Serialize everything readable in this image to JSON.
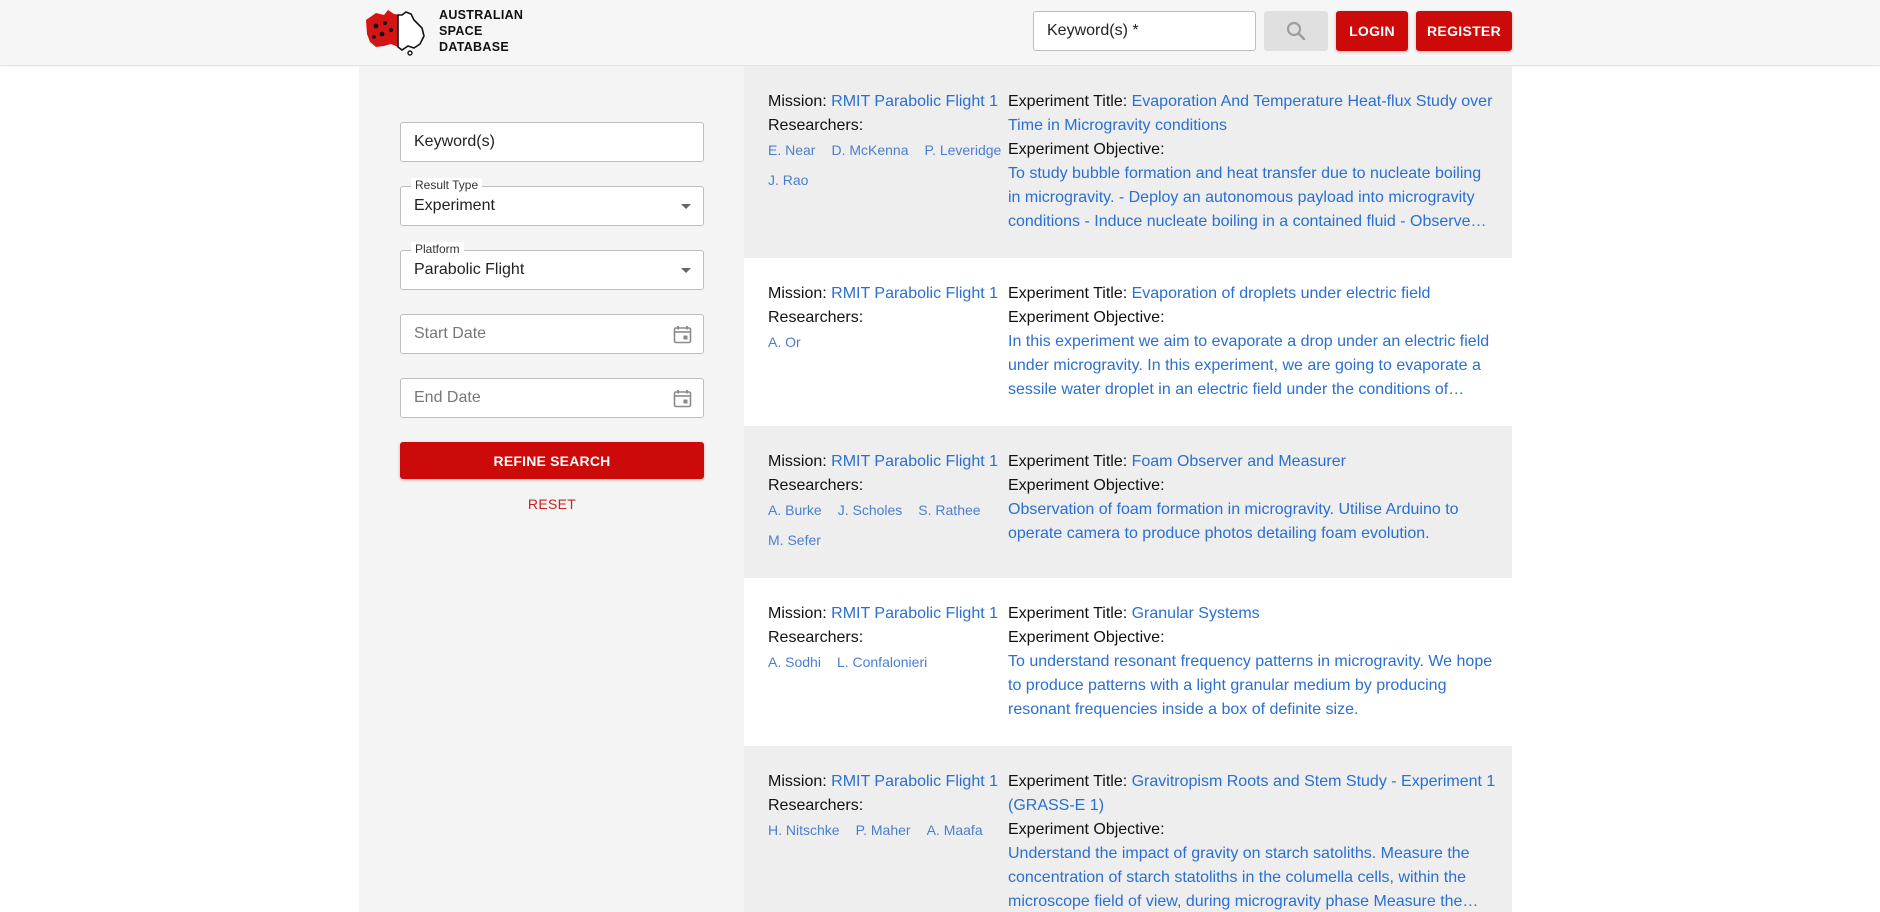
{
  "header": {
    "logo_lines": [
      "AUSTRALIAN",
      "SPACE",
      "DATABASE"
    ],
    "search_value": "Keyword(s) *",
    "search_icon": "search-icon",
    "login_label": "LOGIN",
    "register_label": "REGISTER"
  },
  "filters": {
    "keyword_placeholder": "Keyword(s)",
    "result_type_label": "Result Type",
    "result_type_value": "Experiment",
    "platform_label": "Platform",
    "platform_value": "Parabolic Flight",
    "start_date_placeholder": "Start Date",
    "end_date_placeholder": "End Date",
    "refine_label": "REFINE SEARCH",
    "reset_label": "RESET"
  },
  "labels": {
    "mission": "Mission:",
    "researchers": "Researchers:",
    "experiment_title": "Experiment Title:",
    "experiment_objective": "Experiment Objective:"
  },
  "results": [
    {
      "mission": "RMIT Parabolic Flight 1",
      "researchers": [
        "E. Near",
        "D. McKenna",
        "P. Leveridge",
        "J. Rao"
      ],
      "title": "Evaporation And Temperature Heat-flux Study over Time in Microgravity conditions",
      "objective": "To study bubble formation and heat transfer due to nucleate boiling in microgravity. - Deploy an autonomous payload into microgravity conditions - Induce nucleate boiling in a contained fluid - Observe…"
    },
    {
      "mission": "RMIT Parabolic Flight 1",
      "researchers": [
        "A. Or"
      ],
      "title": "Evaporation of droplets under electric field",
      "objective": "In this experiment we aim to evaporate a drop under an electric field under microgravity. In this experiment, we are going to evaporate a sessile water droplet in an electric field under the conditions of…"
    },
    {
      "mission": "RMIT Parabolic Flight 1",
      "researchers": [
        "A. Burke",
        "J. Scholes",
        "S. Rathee",
        "M. Sefer"
      ],
      "title": "Foam Observer and Measurer",
      "objective": "Observation of foam formation in microgravity. Utilise Arduino to operate camera to produce photos detailing foam evolution."
    },
    {
      "mission": "RMIT Parabolic Flight 1",
      "researchers": [
        "A. Sodhi",
        "L. Confalonieri"
      ],
      "title": "Granular Systems",
      "objective": "To understand resonant frequency patterns in microgravity. We hope to produce patterns with a light granular medium by producing resonant frequencies inside a box of definite size."
    },
    {
      "mission": "RMIT Parabolic Flight 1",
      "researchers": [
        "H. Nitschke",
        "P. Maher",
        "A. Maafa"
      ],
      "title": "Gravitropism Roots and Stem Study - Experiment 1 (GRASS-E 1)",
      "objective": "Understand the impact of gravity on starch satoliths. Measure the concentration of starch statoliths in the columella cells, within the microscope field of view, during microgravity phase Measure the…"
    }
  ]
}
